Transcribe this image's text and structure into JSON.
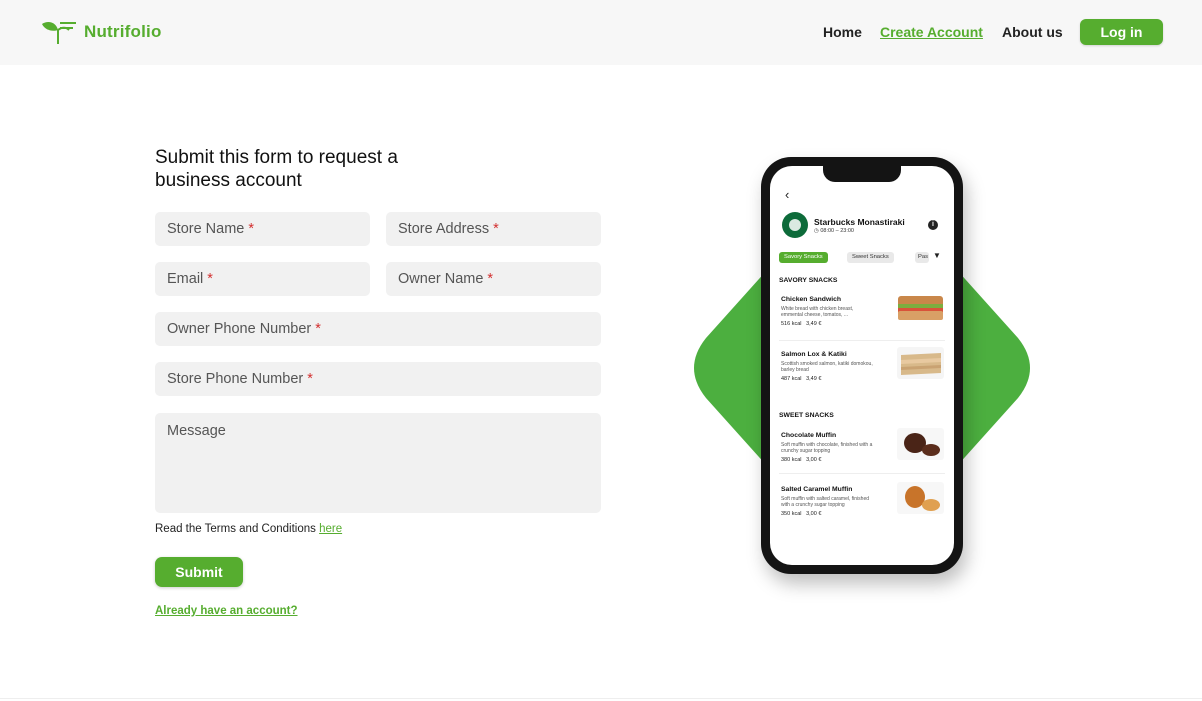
{
  "brand": {
    "name": "Nutrifolio",
    "accent": "#56ad2f"
  },
  "nav": {
    "home": "Home",
    "create_account": "Create Account",
    "about": "About us",
    "login": "Log in"
  },
  "form": {
    "title": "Submit this form to request a business account",
    "required_mark": "*",
    "fields": {
      "store_name": "Store Name",
      "store_address": "Store Address",
      "email": "Email",
      "owner_name": "Owner Name",
      "owner_phone": "Owner Phone Number",
      "store_phone": "Store Phone Number",
      "message": "Message"
    },
    "terms_text": "Read the Terms and Conditions ",
    "terms_link": "here",
    "submit": "Submit",
    "have_account": "Already have an account?"
  },
  "phone_screen": {
    "back_icon": "chevron-left-icon",
    "store_name": "Starbucks Monastiraki",
    "store_hours": "08:00 – 23:00",
    "tabs": [
      "Savory Snacks",
      "Sweet Snacks",
      "Pas"
    ],
    "sections": {
      "savory": "SAVORY SNACKS",
      "sweet": "SWEET SNACKS"
    },
    "items": [
      {
        "name": "Chicken Sandwich",
        "desc": "White bread with chicken breast, emmental cheese, tomatos, ...",
        "kcal": "516 kcal",
        "price": "3,49 €"
      },
      {
        "name": "Salmon Lox & Katiki",
        "desc": "Scottish smoked salmon, katiki domokou, barley bread",
        "kcal": "487 kcal",
        "price": "3,49 €"
      },
      {
        "name": "Chocolate Muffin",
        "desc": "Soft muffin with chocolate, finished with a crunchy sugar topping",
        "kcal": "380 kcal",
        "price": "3,00 €"
      },
      {
        "name": "Salted Caramel Muffin",
        "desc": "Soft muffin with salted caramel, finished with a crunchy sugar topping",
        "kcal": "350 kcal",
        "price": "3,00 €"
      }
    ]
  }
}
